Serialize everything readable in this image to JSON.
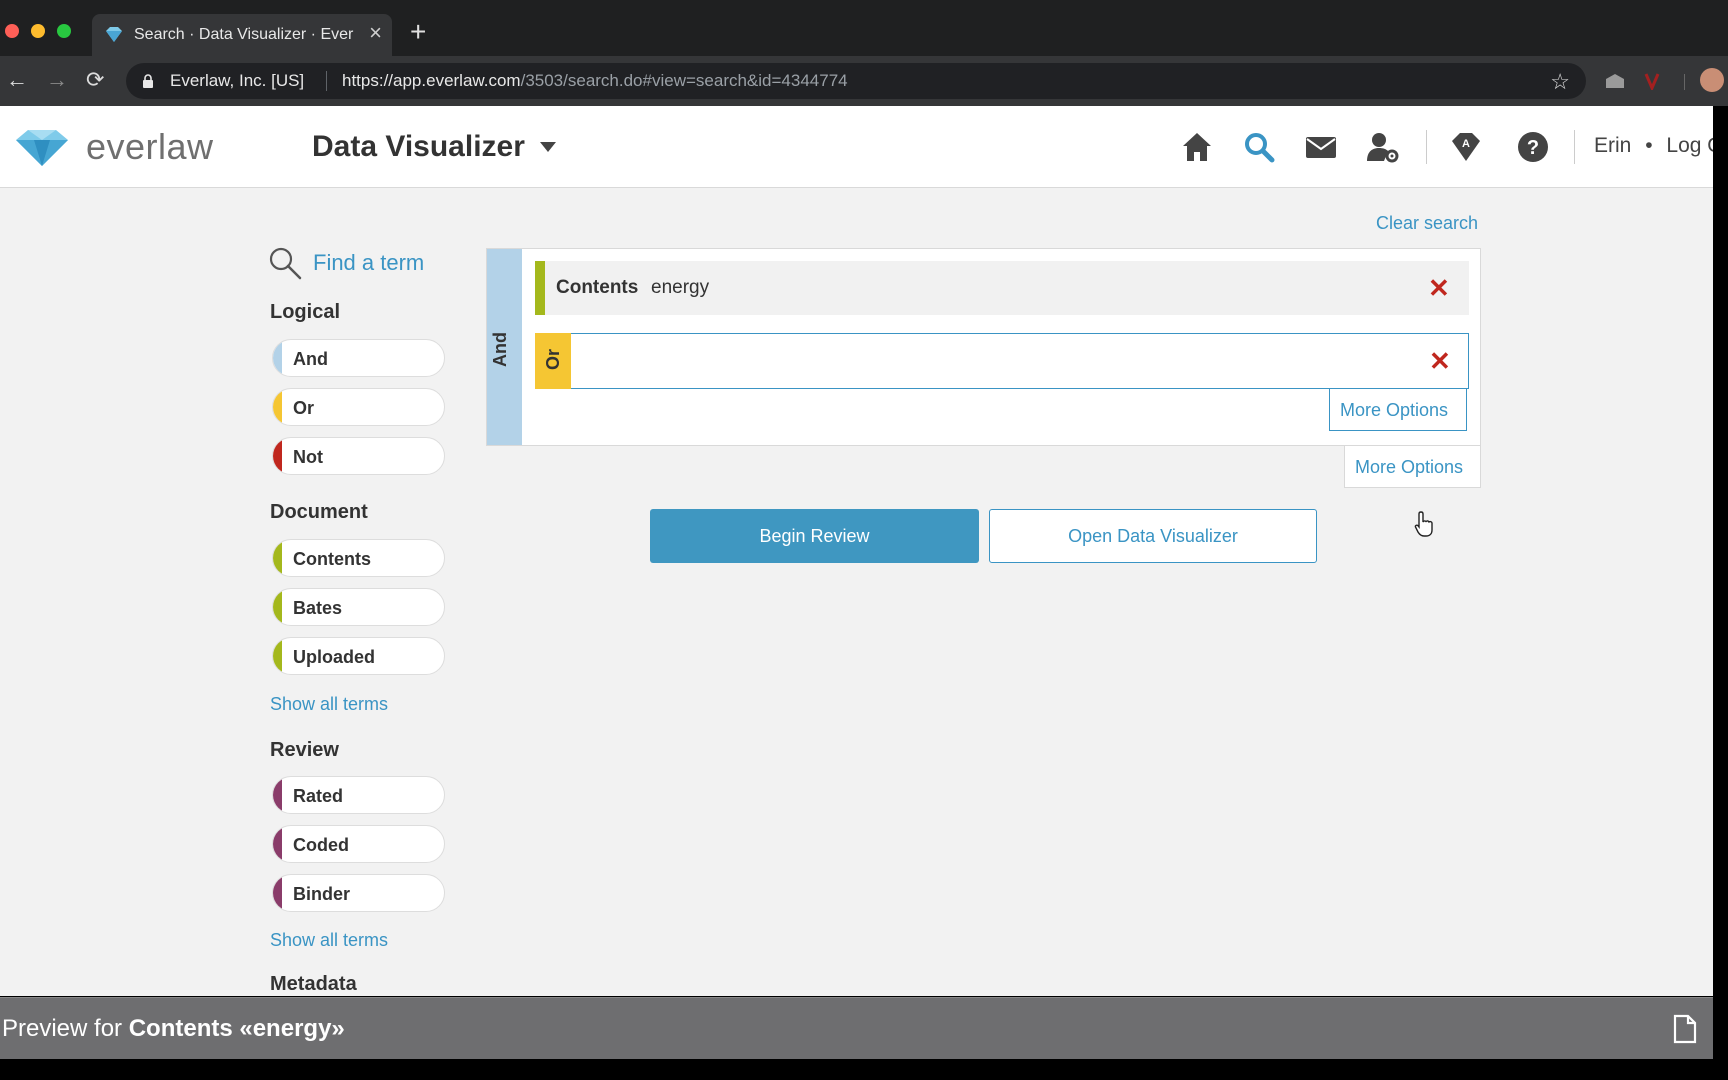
{
  "browser": {
    "tab_title": "Search · Data Visualizer · Everlaw",
    "tab_close": "×",
    "new_tab": "+",
    "site_identity": "Everlaw, Inc. [US]",
    "url_host": "https://app.everlaw.com",
    "url_path": "/3503/search.do#view=search&id=4344774",
    "back": "←",
    "forward": "→",
    "reload": "⟳",
    "star": "☆"
  },
  "header": {
    "logo_text": "everlaw",
    "project_name": "Data Visualizer",
    "icons": [
      "home-icon",
      "search-icon",
      "mail-icon",
      "user-admin-icon",
      "gem-icon",
      "help-icon"
    ],
    "user_name": "Erin",
    "separator": "•",
    "logout": "Log Out"
  },
  "sidebar": {
    "find_label": "Find a term",
    "logical": {
      "title": "Logical",
      "items": [
        {
          "label": "And",
          "color": "#b3d2e8"
        },
        {
          "label": "Or",
          "color": "#f5c633"
        },
        {
          "label": "Not",
          "color": "#c0271e"
        }
      ]
    },
    "document": {
      "title": "Document",
      "items": [
        {
          "label": "Contents",
          "color": "#a4b81c"
        },
        {
          "label": "Bates",
          "color": "#a4b81c"
        },
        {
          "label": "Uploaded",
          "color": "#a4b81c"
        }
      ],
      "show_all": "Show all terms"
    },
    "review": {
      "title": "Review",
      "items": [
        {
          "label": "Rated",
          "color": "#8a3c6a"
        },
        {
          "label": "Coded",
          "color": "#8a3c6a"
        },
        {
          "label": "Binder",
          "color": "#8a3c6a"
        }
      ],
      "show_all": "Show all terms"
    },
    "metadata": {
      "title": "Metadata"
    }
  },
  "query": {
    "clear_search": "Clear search",
    "outer_operator": "And",
    "term": {
      "field": "Contents",
      "value": "energy"
    },
    "nested_operator": "Or",
    "remove": "✕",
    "more_options_inner": "More Options",
    "more_options_outer": "More Options"
  },
  "actions": {
    "begin_review": "Begin Review",
    "open_visualizer": "Open Data Visualizer"
  },
  "preview": {
    "prefix": "Preview for ",
    "subject": "Contents «energy»"
  },
  "colors": {
    "accent": "#3a94c4",
    "and": "#b3d2e8",
    "or": "#f5c633",
    "not": "#c0271e",
    "document": "#a4b81c",
    "review": "#8a3c6a"
  }
}
